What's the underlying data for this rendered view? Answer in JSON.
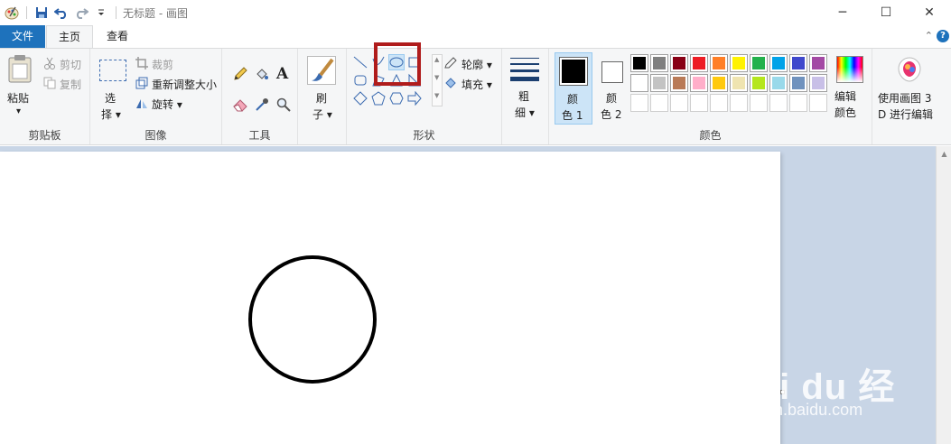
{
  "window": {
    "title": "无标题 - 画图",
    "controls": {
      "minimize": "─",
      "maximize": "☐",
      "close": "✕"
    }
  },
  "tabs": {
    "file": "文件",
    "home": "主页",
    "view": "查看"
  },
  "ribbon": {
    "clipboard": {
      "group": "剪贴板",
      "paste_line1": "粘贴",
      "paste_line2": "▾",
      "cut": "剪切",
      "copy": "复制"
    },
    "image": {
      "group": "图像",
      "select_line1": "选",
      "select_line2": "择 ▾",
      "crop": "裁剪",
      "resize": "重新调整大小",
      "rotate": "旋转 ▾"
    },
    "tools": {
      "group": "工具"
    },
    "brushes": {
      "line1": "刷",
      "line2": "子 ▾"
    },
    "shapes": {
      "group": "形状",
      "outline": "轮廓 ▾",
      "fill": "填充 ▾",
      "selected_shape": "ellipse"
    },
    "size": {
      "line1": "粗",
      "line2": "细 ▾"
    },
    "colors": {
      "group": "颜色",
      "color1_line1": "颜",
      "color1_line2": "色 1",
      "color1_value": "#000000",
      "color2_line1": "颜",
      "color2_line2": "色 2",
      "color2_value": "#ffffff",
      "edit_line1": "编辑",
      "edit_line2": "颜色",
      "palette_row1": [
        "#000000",
        "#7f7f7f",
        "#880015",
        "#ed1c24",
        "#ff7f27",
        "#fff200",
        "#22b14c",
        "#00a2e8",
        "#3f48cc",
        "#a349a4"
      ],
      "palette_row2": [
        "#ffffff",
        "#c3c3c3",
        "#b97a57",
        "#ffaec9",
        "#ffc90e",
        "#efe4b0",
        "#b5e61d",
        "#99d9ea",
        "#7092be",
        "#c8bfe7"
      ]
    },
    "paint3d": {
      "line1": "使用画图 3",
      "line2": "D 进行编辑"
    }
  },
  "watermark": {
    "title": "Bai du 经验",
    "subtitle": "jingyan.baidu.com"
  },
  "colors": {
    "accent": "#1e72bc",
    "highlight_frame": "#b01c1c",
    "workspace": "#c8d5e6"
  }
}
